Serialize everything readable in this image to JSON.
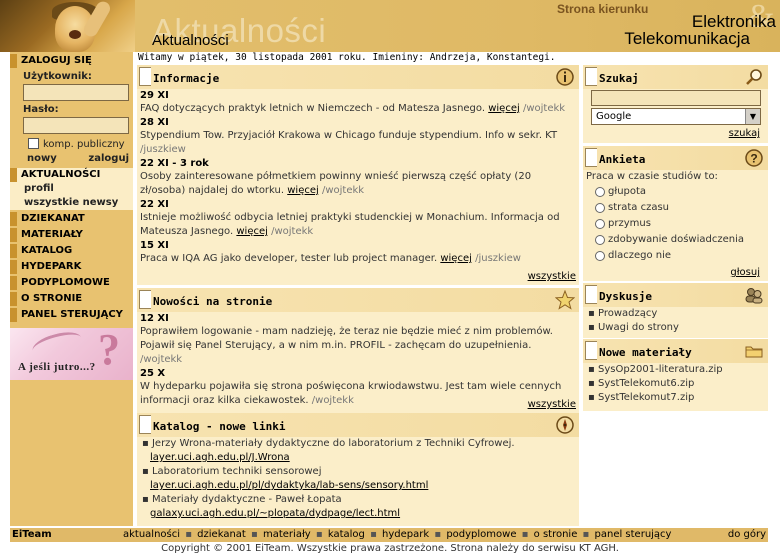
{
  "header": {
    "watermark": "Aktualności",
    "title": "Aktualności",
    "kierunek": "Strona kierunku",
    "line1": "Elektronika",
    "line2": "Telekomunikacja",
    "amp": "&"
  },
  "welcome": "Witamy w piątek, 30 listopada 2001 roku. Imieniny: Andrzeja, Konstantegi.",
  "login": {
    "heading": "ZALOGUJ SIĘ",
    "user_label": "Użytkownik:",
    "user_value": "",
    "pass_label": "Hasło:",
    "pass_value": "",
    "public_label": "komp. publiczny",
    "new_label": "nowy",
    "login_label": "zaloguj"
  },
  "nav": {
    "aktualnosci": "AKTUALNOŚCI",
    "profil": "profil",
    "wszystkie_newsy": "wszystkie newsy",
    "dziekanat": "DZIEKANAT",
    "materialy": "MATERIAŁY",
    "katalog": "KATALOG",
    "hydepark": "HYDEPARK",
    "podyplomowe": "PODYPLOMOWE",
    "o_stronie": "O STRONIE",
    "panel": "PANEL STERUJĄCY"
  },
  "ad": {
    "text": "A jeśli jutro...?",
    "symbol": "?"
  },
  "informacje": {
    "title": "Informacje",
    "icon": "info-icon",
    "items": [
      {
        "date": "29 XI",
        "text": "FAQ dotyczących praktyk letnich w Niemczech - od Matesza Jasnego.",
        "more": "więcej",
        "author": "/wojtekk"
      },
      {
        "date": "28 XI",
        "text": "Stypendium Tow. Przyjaciół Krakowa w Chicago funduje stypendium. Info w sekr. KT",
        "more": "",
        "author": "/juszkiew"
      },
      {
        "date": "22 XI - 3 rok",
        "text": "Osoby zainteresowane półmetkiem powinny wnieść pierwszą część opłaty (20 zł/osoba) najdalej do wtorku.",
        "more": "więcej",
        "author": "/wojtekk"
      },
      {
        "date": "22 XI",
        "text": "Istnieje możliwość odbycia letniej praktyki studenckiej w Monachium. Informacja od Mateusza Jasnego.",
        "more": "więcej",
        "author": "/wojtekk"
      },
      {
        "date": "15 XI",
        "text": "Praca w IQA AG jako developer, tester lub project manager.",
        "more": "więcej",
        "author": "/juszkiew"
      }
    ],
    "all_link": "wszystkie"
  },
  "nowosci": {
    "title": "Nowości na stronie",
    "icon": "star-icon",
    "items": [
      {
        "date": "12 XI",
        "text": "Poprawiłem logowanie - mam nadzieję, że teraz nie będzie mieć z nim problemów. Pojawił się Panel Sterujący, a w nim m.in. PROFIL - zachęcam do uzupełnienia.",
        "author": "/wojtekk"
      },
      {
        "date": "25 X",
        "text": "W hydeparku pojawiła się strona poświęcona krwiodawstwu. Jest tam wiele cennych informacji oraz kilka ciekawostek.",
        "author": "/wojtekk"
      }
    ],
    "all_link": "wszystkie"
  },
  "katalog": {
    "title": "Katalog - nowe linki",
    "icon": "compass-icon",
    "items": [
      {
        "text": "Jerzy Wrona-materiały dydaktyczne do laboratorium z Techniki Cyfrowej.",
        "link": "layer.uci.agh.edu.pl/J.Wrona"
      },
      {
        "text": "Laboratorium techniki sensorowej",
        "link": "layer.uci.agh.edu.pl/pl/dydaktyka/lab-sens/sensory.html"
      },
      {
        "text": "Materiały dydaktyczne - Paweł Łopata",
        "link": "galaxy.uci.agh.edu.pl/~plopata/dydpage/lect.html"
      }
    ]
  },
  "szukaj": {
    "title": "Szukaj",
    "icon": "magnifier-icon",
    "input_value": "",
    "engine": "Google",
    "button": "szukaj"
  },
  "ankieta": {
    "title": "Ankieta",
    "icon": "question-icon",
    "question": "Praca w czasie studiów to:",
    "options": [
      "głupota",
      "strata czasu",
      "przymus",
      "zdobywanie doświadczenia",
      "dlaczego nie"
    ],
    "vote": "głosuj"
  },
  "dyskusje": {
    "title": "Dyskusje",
    "icon": "people-icon",
    "items": [
      "Prowadzący",
      "Uwagi do strony"
    ]
  },
  "nowe_materialy": {
    "title": "Nowe materiały",
    "icon": "folder-icon",
    "items": [
      "SysOp2001-literatura.zip",
      "SystTelekomut6.zip",
      "SystTelekomut7.zip"
    ]
  },
  "footer": {
    "brand": "EiTeam",
    "links": [
      "aktualności",
      "dziekanat",
      "materiały",
      "katalog",
      "hydepark",
      "podyplomowe",
      "o stronie",
      "panel sterujący"
    ],
    "top": "do góry",
    "copyright": "Copyright © 2001 EiTeam. Wszystkie prawa zastrzeżone. Strona należy do serwisu KT AGH."
  },
  "colors": {
    "header": "#ddb55e",
    "sidebar": "#e8c270",
    "box": "#fbeec9",
    "accent": "#c8922e"
  }
}
